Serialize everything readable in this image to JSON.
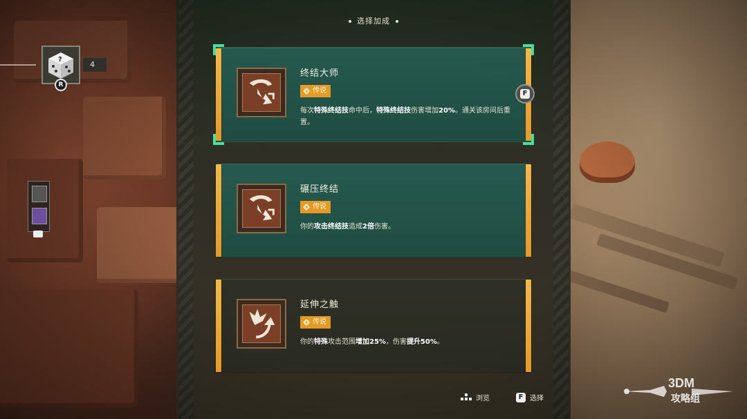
{
  "header": {
    "title": "选择加成"
  },
  "hud": {
    "dice_count": "4",
    "dice_key": "R",
    "side_key_label": "▪"
  },
  "cards": [
    {
      "title": "终结大师",
      "rarity": "传说",
      "selected": true,
      "desc_parts": [
        {
          "text": "每次",
          "bold": false
        },
        {
          "text": "特殊终结技",
          "bold": true
        },
        {
          "text": "命中后，",
          "bold": false
        },
        {
          "text": "特殊终结技",
          "bold": true
        },
        {
          "text": "伤害增加",
          "bold": false
        },
        {
          "text": "20%",
          "bold": true
        },
        {
          "text": "。通关该房间后重置。",
          "bold": false
        }
      ],
      "icon": "sickle-strike-icon"
    },
    {
      "title": "碾压终结",
      "rarity": "传说",
      "selected": false,
      "desc_parts": [
        {
          "text": "你的",
          "bold": false
        },
        {
          "text": "攻击终结技",
          "bold": true
        },
        {
          "text": "造成",
          "bold": false
        },
        {
          "text": "2倍",
          "bold": true
        },
        {
          "text": "伤害。",
          "bold": false
        }
      ],
      "icon": "sickle-strike-icon"
    },
    {
      "title": "延伸之触",
      "rarity": "传说",
      "selected": false,
      "desc_parts": [
        {
          "text": "你的",
          "bold": false
        },
        {
          "text": "特殊",
          "bold": true
        },
        {
          "text": "攻击范围",
          "bold": false
        },
        {
          "text": "增加25%",
          "bold": true
        },
        {
          "text": "，伤害",
          "bold": false
        },
        {
          "text": "提升50%",
          "bold": true
        },
        {
          "text": "。",
          "bold": false
        }
      ],
      "icon": "burst-arrow-icon"
    }
  ],
  "f_prompt": "F",
  "footer": {
    "browse_label": "浏览",
    "select_key": "F",
    "select_label": "选择"
  },
  "watermark": {
    "line1": "3DM",
    "line2": "攻略组"
  },
  "colors": {
    "card_teal": "#265d52",
    "card_dark": "#2e3026",
    "accent_orange": "#e59a26",
    "selection_green": "#43e0a4"
  }
}
